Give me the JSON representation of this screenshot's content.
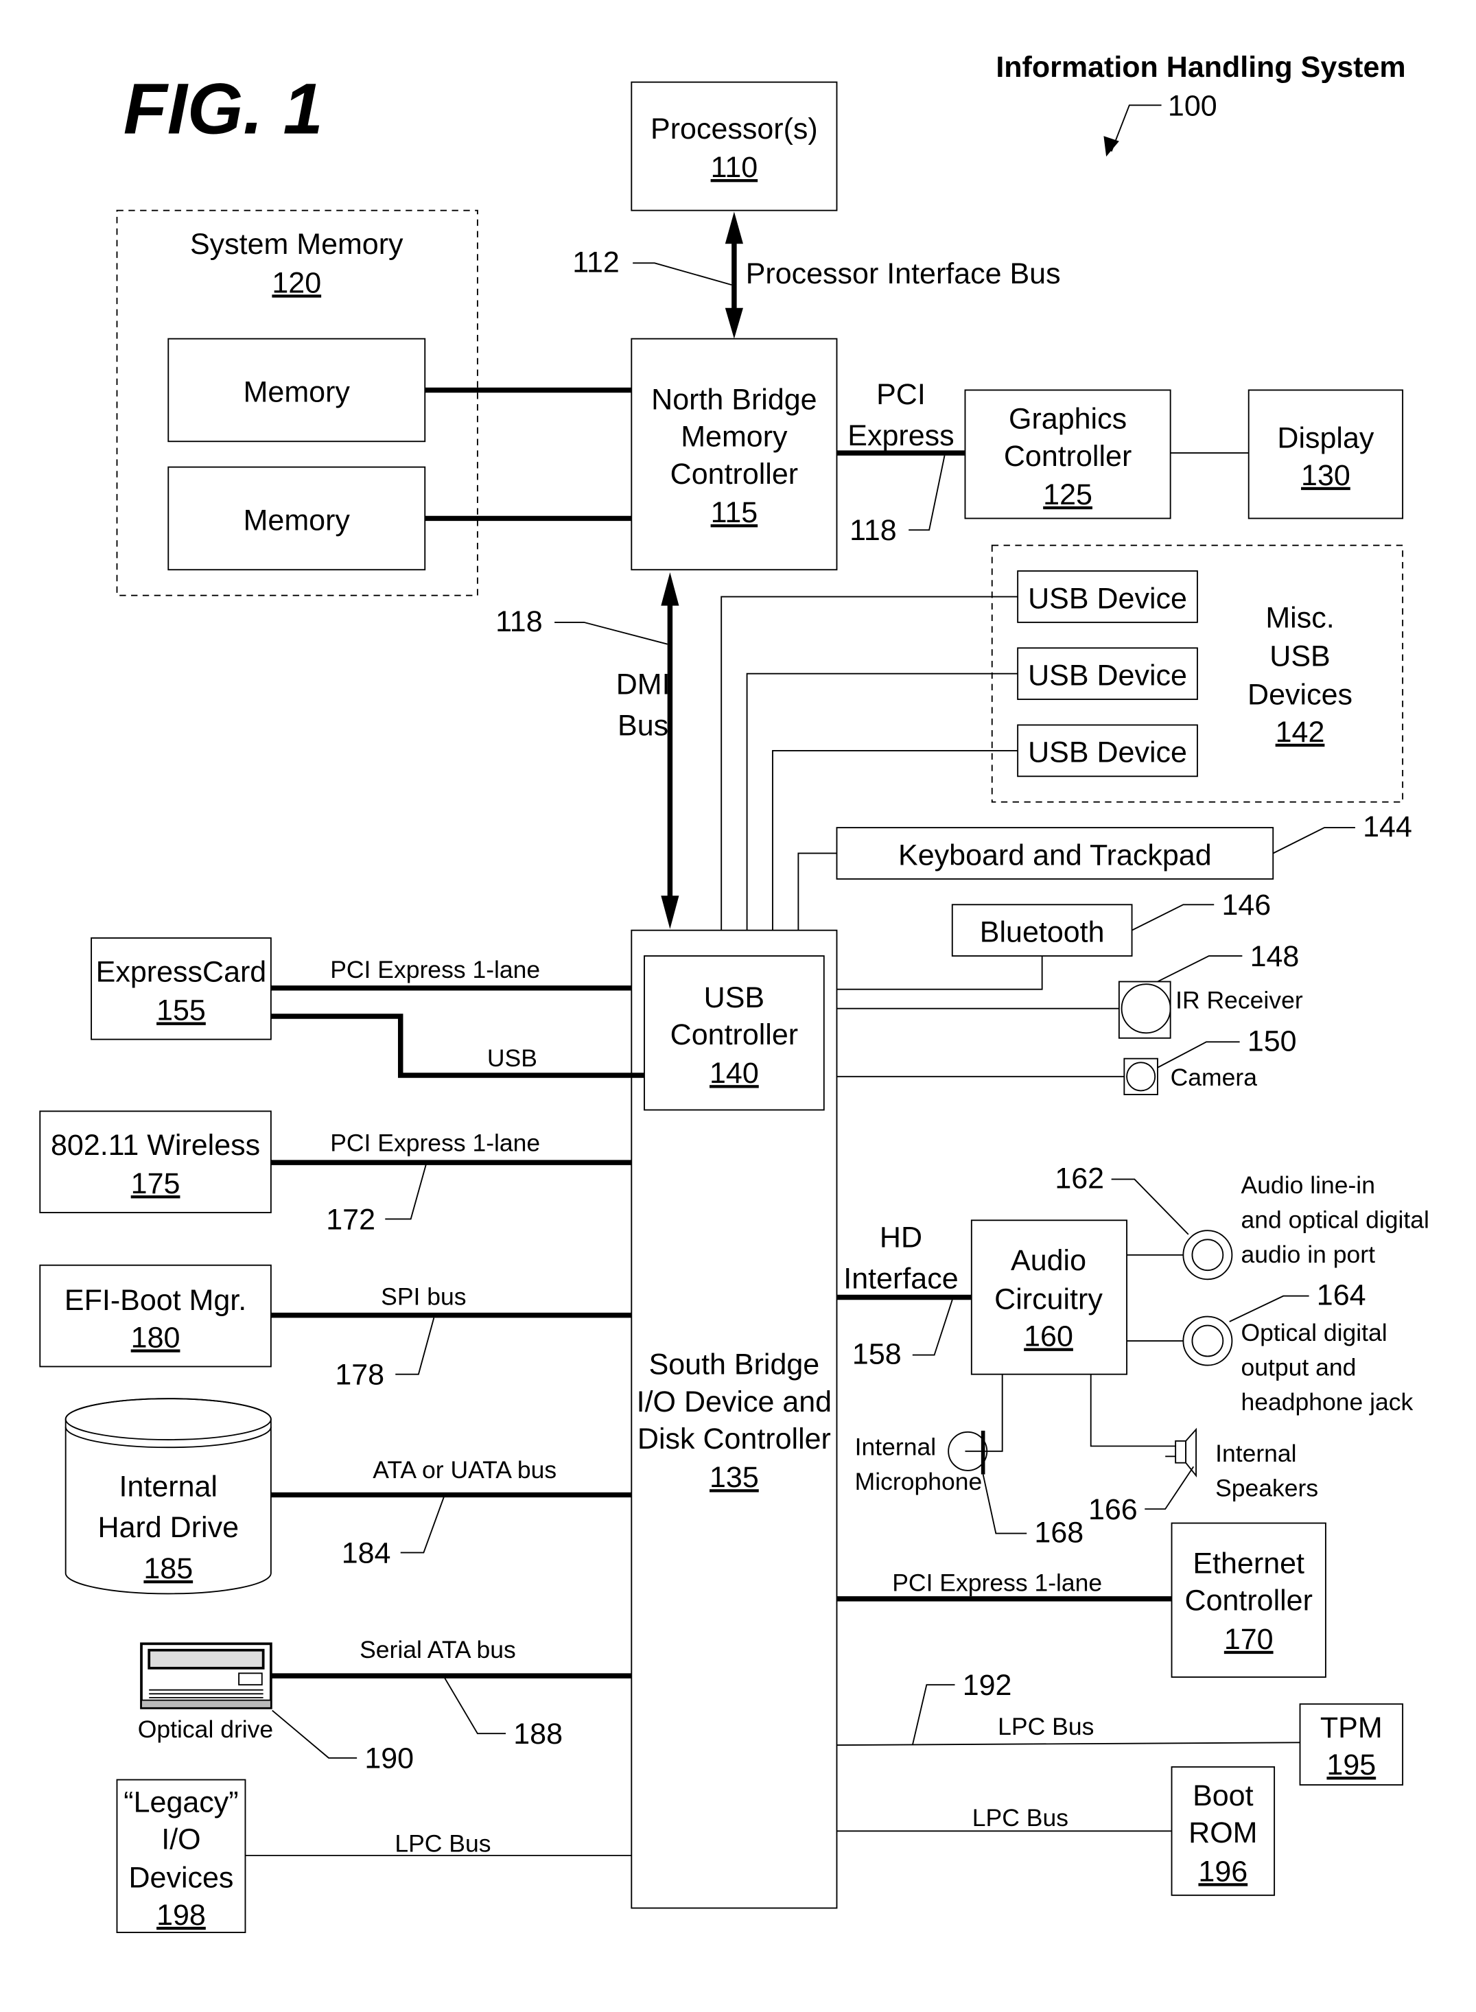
{
  "figure_label": "FIG. 1",
  "system": {
    "title": "Information Handling System",
    "ref": "100"
  },
  "blocks": {
    "processor": {
      "lines": [
        "Processor(s)"
      ],
      "num": "110"
    },
    "system_memory": {
      "lines": [
        "System Memory"
      ],
      "num": "120"
    },
    "memory_1": {
      "lines": [
        "Memory"
      ]
    },
    "memory_2": {
      "lines": [
        "Memory"
      ]
    },
    "north_bridge": {
      "lines": [
        "North Bridge",
        "Memory",
        "Controller"
      ],
      "num": "115"
    },
    "graphics": {
      "lines": [
        "Graphics",
        "Controller"
      ],
      "num": "125"
    },
    "display": {
      "lines": [
        "Display"
      ],
      "num": "130"
    },
    "misc_usb": {
      "lines": [
        "Misc.",
        "USB",
        "Devices"
      ],
      "num": "142"
    },
    "usb_device_1": {
      "lines": [
        "USB Device"
      ]
    },
    "usb_device_2": {
      "lines": [
        "USB Device"
      ]
    },
    "usb_device_3": {
      "lines": [
        "USB Device"
      ]
    },
    "keyboard": {
      "lines": [
        "Keyboard and Trackpad"
      ]
    },
    "bluetooth": {
      "lines": [
        "Bluetooth"
      ]
    },
    "ir_receiver": {
      "lines": [
        "IR Receiver"
      ]
    },
    "camera": {
      "lines": [
        "Camera"
      ]
    },
    "usb_controller": {
      "lines": [
        "USB",
        "Controller"
      ],
      "num": "140"
    },
    "south_bridge": {
      "lines": [
        "South Bridge",
        "I/O Device and",
        "Disk Controller"
      ],
      "num": "135"
    },
    "expresscard": {
      "lines": [
        "ExpressCard"
      ],
      "num": "155"
    },
    "wireless": {
      "lines": [
        "802.11 Wireless"
      ],
      "num": "175"
    },
    "efi": {
      "lines": [
        "EFI-Boot Mgr."
      ],
      "num": "180"
    },
    "hard_drive": {
      "lines": [
        "Internal",
        "Hard Drive"
      ],
      "num": "185"
    },
    "optical": {
      "lines": [
        "Optical drive"
      ]
    },
    "legacy": {
      "lines": [
        "“Legacy”",
        "I/O",
        "Devices"
      ],
      "num": "198"
    },
    "audio": {
      "lines": [
        "Audio",
        "Circuitry"
      ],
      "num": "160"
    },
    "audio_in": {
      "lines": [
        "Audio line-in",
        "and optical digital",
        "audio in port"
      ]
    },
    "audio_out": {
      "lines": [
        "Optical digital",
        "output and",
        "headphone jack"
      ]
    },
    "microphone": {
      "lines": [
        "Internal",
        "Microphone"
      ]
    },
    "speakers": {
      "lines": [
        "Internal",
        "Speakers"
      ]
    },
    "ethernet": {
      "lines": [
        "Ethernet",
        "Controller"
      ],
      "num": "170"
    },
    "tpm": {
      "lines": [
        "TPM"
      ],
      "num": "195"
    },
    "boot_rom": {
      "lines": [
        "Boot",
        "ROM"
      ],
      "num": "196"
    }
  },
  "buses": {
    "processor_bus": "Processor Interface Bus",
    "pci_express": [
      "PCI",
      "Express"
    ],
    "dmi": [
      "DMI",
      "Bus"
    ],
    "pcie_expresscard": "PCI Express 1-lane",
    "usb_expresscard": "USB",
    "pcie_wireless": "PCI Express 1-lane",
    "spi": "SPI bus",
    "ata": "ATA or UATA bus",
    "sata": "Serial ATA bus",
    "lpc_legacy": "LPC Bus",
    "hd_interface": [
      "HD",
      "Interface"
    ],
    "pcie_ethernet": "PCI Express 1-lane",
    "lpc_tpm": "LPC Bus",
    "lpc_bootrom": "LPC Bus"
  },
  "refs": {
    "r112": "112",
    "r118a": "118",
    "r118b": "118",
    "r144": "144",
    "r146": "146",
    "r148": "148",
    "r150": "150",
    "r172": "172",
    "r178": "178",
    "r184": "184",
    "r188": "188",
    "r190": "190",
    "r158": "158",
    "r162": "162",
    "r164": "164",
    "r166": "166",
    "r168": "168",
    "r192": "192"
  }
}
